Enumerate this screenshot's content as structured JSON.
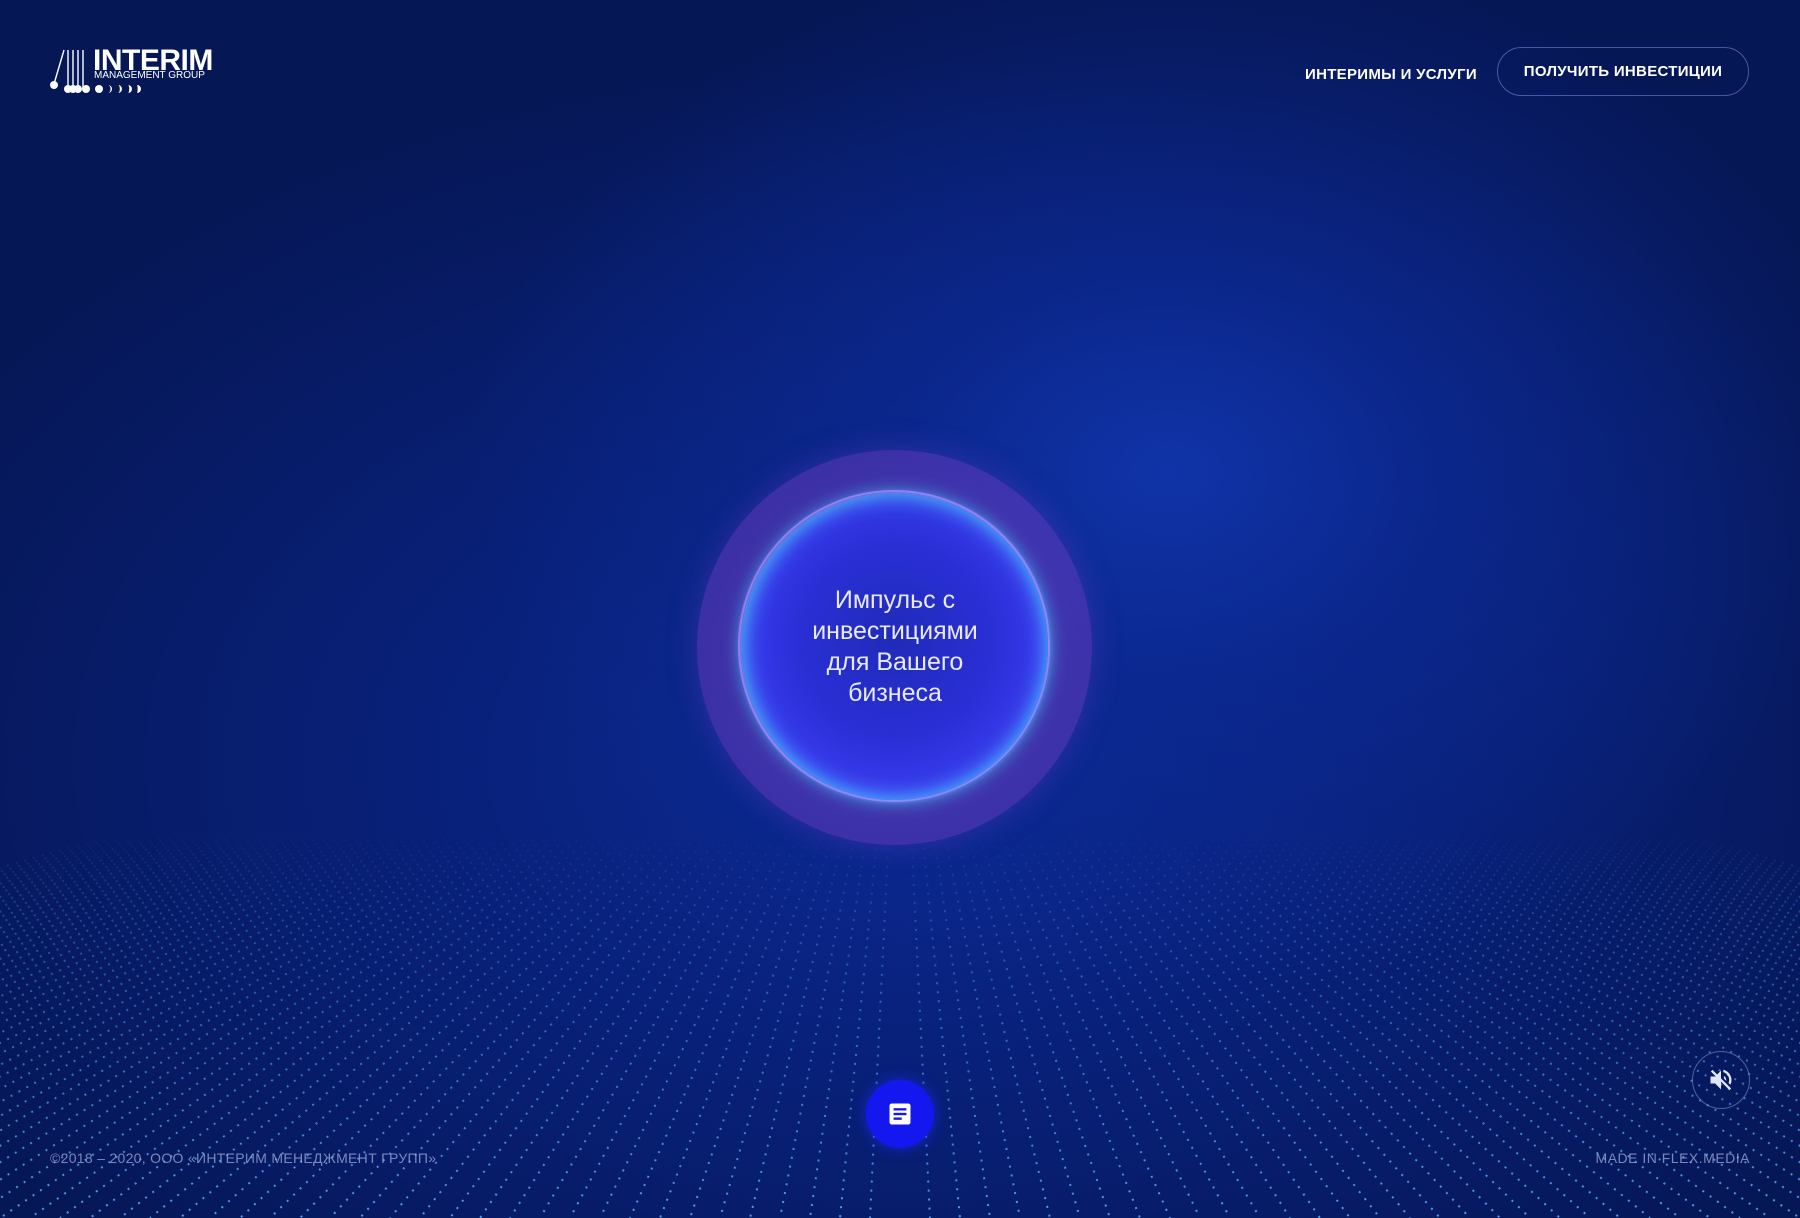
{
  "header": {
    "logo_title": "INTERIM",
    "logo_subtitle": "MANAGEMENT GROUP",
    "nav_link": "ИНТЕРИМЫ И УСЛУГИ",
    "cta_button": "ПОЛУЧИТЬ ИНВЕСТИЦИИ"
  },
  "hero": {
    "orb_text": "Импульс с инвестициями для Вашего бизнеса"
  },
  "controls": {
    "document_icon": "document-icon",
    "mute_icon": "volume-off-icon"
  },
  "footer": {
    "copyright": "©2018 – 2020, ООО «ИНТЕРИМ МЕНЕДЖМЕНТ ГРУПП»",
    "credit": "MADE IN FLEX.MEDIA"
  },
  "colors": {
    "background": "#071a55",
    "glow": "#0b2a94",
    "orb_core": "#2a2fd6",
    "orb_rim": "#3fc8ff",
    "orb_halo": "#8c46d2",
    "doc_button": "#1418ee"
  }
}
